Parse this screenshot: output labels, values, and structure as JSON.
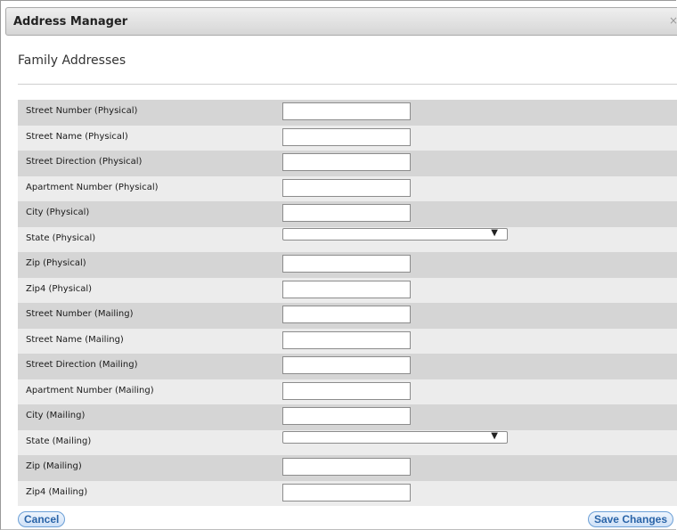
{
  "dialog": {
    "title": "Address Manager",
    "close_glyph": "×"
  },
  "section": {
    "title": "Family Addresses"
  },
  "fields": [
    {
      "label": "Street Number (Physical)",
      "type": "text",
      "value": ""
    },
    {
      "label": "Street Name (Physical)",
      "type": "text",
      "value": ""
    },
    {
      "label": "Street Direction (Physical)",
      "type": "text",
      "value": ""
    },
    {
      "label": "Apartment Number (Physical)",
      "type": "text",
      "value": ""
    },
    {
      "label": "City (Physical)",
      "type": "text",
      "value": ""
    },
    {
      "label": "State (Physical)",
      "type": "select",
      "value": ""
    },
    {
      "label": "Zip (Physical)",
      "type": "text",
      "value": ""
    },
    {
      "label": "Zip4 (Physical)",
      "type": "text",
      "value": ""
    },
    {
      "label": "Street Number (Mailing)",
      "type": "text",
      "value": ""
    },
    {
      "label": "Street Name (Mailing)",
      "type": "text",
      "value": ""
    },
    {
      "label": "Street Direction (Mailing)",
      "type": "text",
      "value": ""
    },
    {
      "label": "Apartment Number (Mailing)",
      "type": "text",
      "value": ""
    },
    {
      "label": "City (Mailing)",
      "type": "text",
      "value": ""
    },
    {
      "label": "State (Mailing)",
      "type": "select",
      "value": ""
    },
    {
      "label": "Zip (Mailing)",
      "type": "text",
      "value": ""
    },
    {
      "label": "Zip4 (Mailing)",
      "type": "text",
      "value": ""
    }
  ],
  "buttons": {
    "cancel": "Cancel",
    "save": "Save Changes"
  },
  "icons": {
    "dropdown": "▼"
  },
  "colors": {
    "row_dark": "#d5d5d5",
    "row_light": "#ececec",
    "button_text": "#2a64a8"
  }
}
